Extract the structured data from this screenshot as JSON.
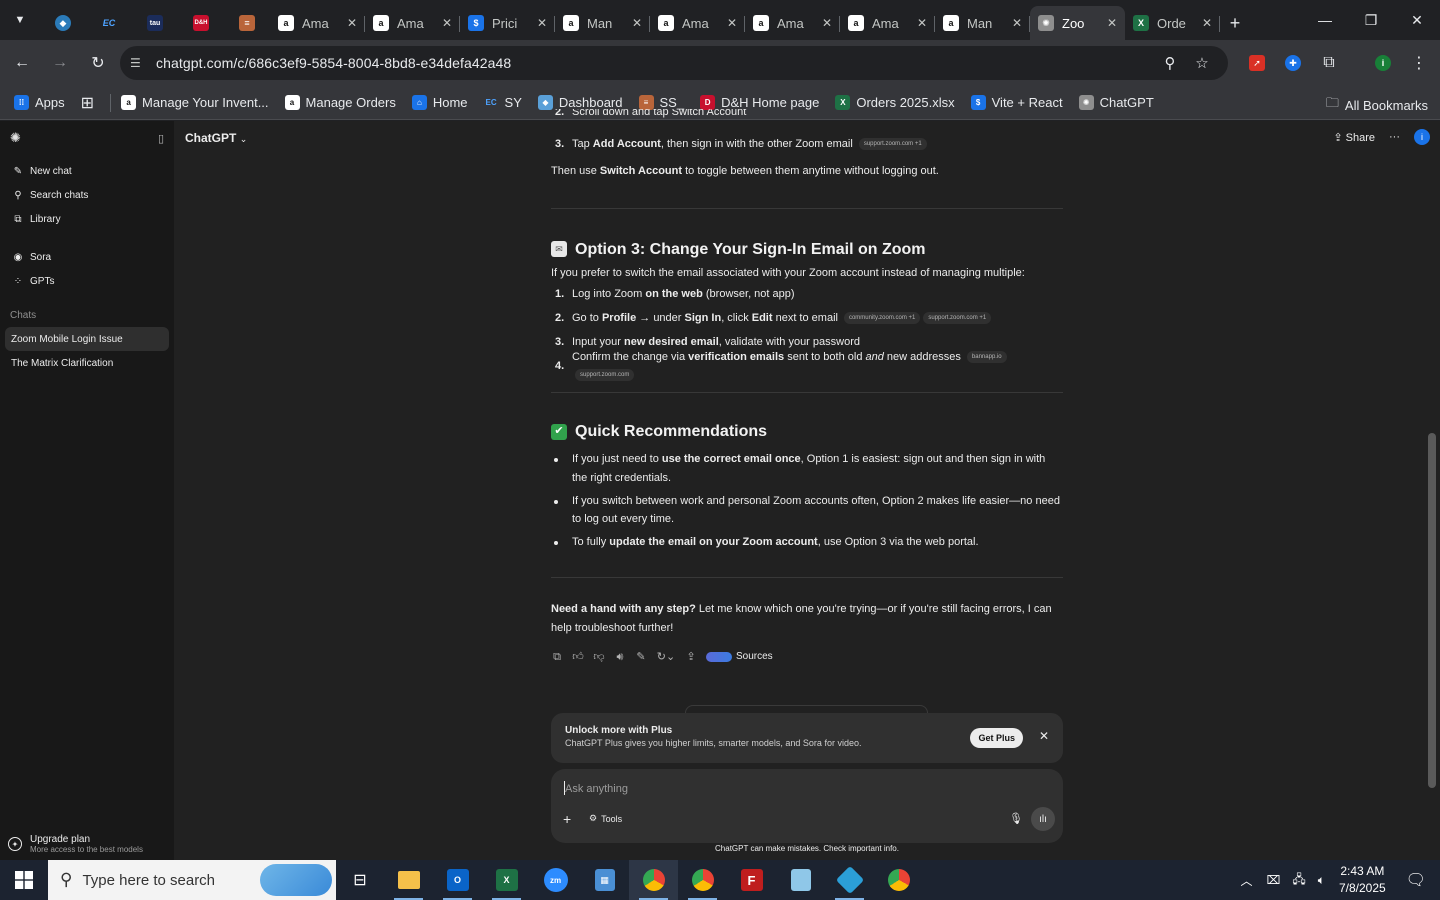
{
  "browser": {
    "tabs": [
      {
        "title": "Ama",
        "favicon": "amazon-icon"
      },
      {
        "title": "Ama",
        "favicon": "amazon-icon"
      },
      {
        "title": "Prici",
        "favicon": "dollar-icon"
      },
      {
        "title": "Man",
        "favicon": "amazon-icon"
      },
      {
        "title": "Ama",
        "favicon": "amazon-icon"
      },
      {
        "title": "Ama",
        "favicon": "amazon-icon"
      },
      {
        "title": "Ama",
        "favicon": "amazon-icon"
      },
      {
        "title": "Man",
        "favicon": "amazon-icon"
      },
      {
        "title": "Zoo",
        "favicon": "chatgpt-icon",
        "active": true
      },
      {
        "title": "Orde",
        "favicon": "excel-icon"
      }
    ],
    "pinned_labels": [
      "EC",
      "tau",
      "D&H"
    ],
    "url": "chatgpt.com/c/686c3ef9-5854-8004-8bd8-e34defa42a48",
    "bookmarks": [
      {
        "label": "Apps"
      },
      {
        "label": "Manage Your Invent..."
      },
      {
        "label": "Manage Orders"
      },
      {
        "label": "Home"
      },
      {
        "label": "SY"
      },
      {
        "label": "Dashboard"
      },
      {
        "label": "SS_"
      },
      {
        "label": "D&H Home page"
      },
      {
        "label": "Orders 2025.xlsx"
      },
      {
        "label": "Vite + React"
      },
      {
        "label": "ChatGPT"
      }
    ],
    "all_bookmarks": "All Bookmarks",
    "profile_initial": "i"
  },
  "sidebar": {
    "items": [
      {
        "label": "New chat",
        "icon": "edit-icon"
      },
      {
        "label": "Search chats",
        "icon": "search-icon"
      },
      {
        "label": "Library",
        "icon": "library-icon"
      }
    ],
    "items2": [
      {
        "label": "Sora",
        "icon": "sora-icon"
      },
      {
        "label": "GPTs",
        "icon": "grid-icon"
      }
    ],
    "chats_label": "Chats",
    "chats": [
      {
        "label": "Zoom Mobile Login Issue",
        "active": true
      },
      {
        "label": "The Matrix Clarification"
      }
    ],
    "upgrade_title": "Upgrade plan",
    "upgrade_sub": "More access to the best models"
  },
  "topbar": {
    "title": "ChatGPT",
    "share": "Share",
    "avatar": "i"
  },
  "message": {
    "partial_step": {
      "num": "2.",
      "text": "Scroll down and tap Switch Account"
    },
    "step3": {
      "num": "3.",
      "pre": "Tap ",
      "bold": "Add Account",
      "post": ", then sign in with the other Zoom email",
      "cite": "support.zoom.com +1"
    },
    "then_line": {
      "pre": "Then use ",
      "bold": "Switch Account",
      "post": " to toggle between them anytime without logging out."
    },
    "option3": {
      "title": "Option 3: Change Your Sign-In Email on Zoom",
      "intro": "If you prefer to switch the email associated with your Zoom account instead of managing multiple:",
      "steps": [
        {
          "num": "1.",
          "a": "Log into Zoom ",
          "b": "on the web",
          "c": " (browser, not app)"
        },
        {
          "num": "2.",
          "a": "Go to ",
          "b": "Profile",
          "c": " → under ",
          "d": "Sign In",
          "e": ", click ",
          "f": "Edit",
          "g": " next to email",
          "cite1": "community.zoom.com +1",
          "cite2": "support.zoom.com +1"
        },
        {
          "num": "3.",
          "a": "Input your ",
          "b": "new desired email",
          "c": ", validate with your password"
        },
        {
          "num": "4.",
          "a": "Confirm the change via ",
          "b": "verification emails",
          "c": " sent to both old ",
          "d": "and",
          "e": " new addresses",
          "cite1": "bannapp.io",
          "cite2": "support.zoom.com"
        }
      ]
    },
    "recs": {
      "title": "Quick Recommendations",
      "items": [
        {
          "a": "If you just need to ",
          "b": "use the correct email once",
          "c": ", Option 1 is easiest: sign out and then sign in with the right credentials."
        },
        {
          "a": "If you switch between work and personal Zoom accounts often, Option 2 makes life easier—no need to log out every time."
        },
        {
          "a": "To fully ",
          "b": "update the email on your Zoom account",
          "c": ", use Option 3 via the web portal."
        }
      ]
    },
    "closing": {
      "bold": "Need a hand with any step?",
      "rest": " Let me know which one you're trying—or if you're still facing errors, I can help troubleshoot further!"
    },
    "sources": "Sources"
  },
  "upsell": {
    "title": "Unlock more with Plus",
    "sub": "ChatGPT Plus gives you higher limits, smarter models, and Sora for video.",
    "button": "Get Plus"
  },
  "composer": {
    "placeholder": "Ask anything",
    "tools": "Tools"
  },
  "disclaimer": "ChatGPT can make mistakes. Check important info.",
  "taskbar": {
    "search_placeholder": "Type here to search",
    "time": "2:43 AM",
    "date": "7/8/2025"
  }
}
